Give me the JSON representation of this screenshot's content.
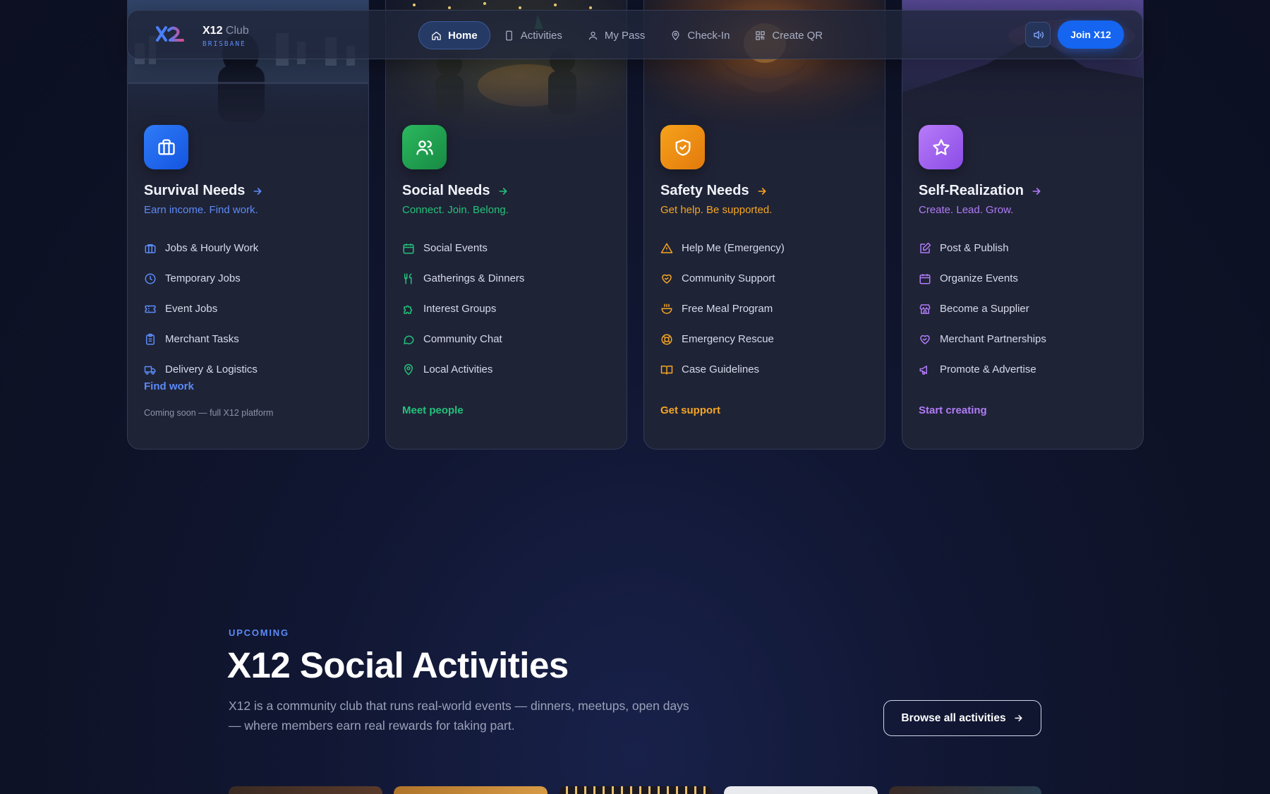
{
  "nav": {
    "brand_name": "X12",
    "brand_suffix": "Club",
    "brand_city": "BRISBANE",
    "links": [
      {
        "label": "Home",
        "icon": "home-icon"
      },
      {
        "label": "Activities",
        "icon": "phone-icon"
      },
      {
        "label": "My Pass",
        "icon": "user-icon"
      },
      {
        "label": "Check-In",
        "icon": "map-pin-icon"
      },
      {
        "label": "Create QR",
        "icon": "qr-code-icon"
      }
    ],
    "sound_icon": "volume-icon",
    "join_label": "Join X12"
  },
  "cards": [
    {
      "title": "Survival Needs",
      "tagline": "Earn income. Find work.",
      "accent": "#5b8bf7",
      "icon": "briefcase-icon",
      "items": [
        {
          "label": "Jobs & Hourly Work",
          "icon": "briefcase-icon"
        },
        {
          "label": "Temporary Jobs",
          "icon": "clock-icon"
        },
        {
          "label": "Event Jobs",
          "icon": "ticket-icon"
        },
        {
          "label": "Merchant Tasks",
          "icon": "clipboard-icon"
        },
        {
          "label": "Delivery & Logistics",
          "icon": "truck-icon"
        }
      ],
      "cta": "Find work",
      "note": "Coming soon — full X12 platform"
    },
    {
      "title": "Social Needs",
      "tagline": "Connect. Join. Belong.",
      "accent": "#22c27a",
      "icon": "users-icon",
      "items": [
        {
          "label": "Social Events",
          "icon": "calendar-icon"
        },
        {
          "label": "Gatherings & Dinners",
          "icon": "utensils-icon"
        },
        {
          "label": "Interest Groups",
          "icon": "puzzle-icon"
        },
        {
          "label": "Community Chat",
          "icon": "chat-icon"
        },
        {
          "label": "Local Activities",
          "icon": "map-pin-icon"
        }
      ],
      "cta": "Meet people"
    },
    {
      "title": "Safety Needs",
      "tagline": "Get help. Be supported.",
      "accent": "#f5a623",
      "icon": "shield-check-icon",
      "items": [
        {
          "label": "Help Me (Emergency)",
          "icon": "alert-triangle-icon"
        },
        {
          "label": "Community Support",
          "icon": "heart-handshake-icon"
        },
        {
          "label": "Free Meal Program",
          "icon": "soup-icon"
        },
        {
          "label": "Emergency Rescue",
          "icon": "life-buoy-icon"
        },
        {
          "label": "Case Guidelines",
          "icon": "book-icon"
        }
      ],
      "cta": "Get support"
    },
    {
      "title": "Self-Realization",
      "tagline": "Create. Lead. Grow.",
      "accent": "#b07cf7",
      "icon": "star-icon",
      "items": [
        {
          "label": "Post & Publish",
          "icon": "edit-icon"
        },
        {
          "label": "Organize Events",
          "icon": "calendar-icon"
        },
        {
          "label": "Become a Supplier",
          "icon": "store-icon"
        },
        {
          "label": "Merchant Partnerships",
          "icon": "handshake-icon"
        },
        {
          "label": "Promote & Advertise",
          "icon": "megaphone-icon"
        }
      ],
      "cta": "Start creating"
    }
  ],
  "section": {
    "eyebrow": "UPCOMING",
    "title": "X12 Social Activities",
    "description": "X12 is a community club that runs real-world events — dinners, meetups, open days — where members earn real rewards for taking part.",
    "browse_label": "Browse all activities"
  },
  "colors": {
    "background": "#0f1428",
    "card": "#1f2336",
    "primary": "#1565f0"
  }
}
